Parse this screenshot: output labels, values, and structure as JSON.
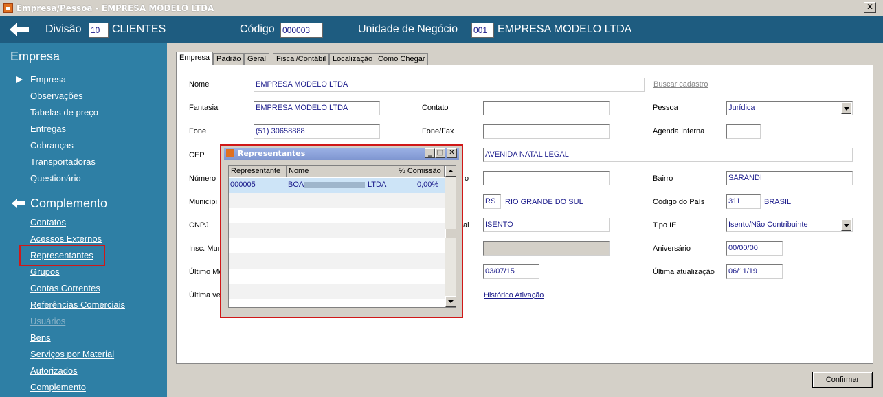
{
  "window": {
    "title": "Empresa/Pessoa - EMPRESA MODELO LTDA",
    "close": "✕"
  },
  "topbar": {
    "divisao_label": "Divisão",
    "divisao_code": "10",
    "divisao_name": "CLIENTES",
    "codigo_label": "Código",
    "codigo_value": "000003",
    "unidade_label": "Unidade de Negócio",
    "unidade_code": "001",
    "unidade_name": "EMPRESA MODELO LTDA"
  },
  "sidebar": {
    "section1": "Empresa",
    "items1": [
      "Empresa",
      "Observações",
      "Tabelas de preço",
      "Entregas",
      "Cobranças",
      "Transportadoras",
      "Questionário"
    ],
    "section2": "Complemento",
    "items2": [
      "Contatos",
      "Acessos Externos",
      "Representantes",
      "Grupos",
      "Contas Correntes",
      "Referências Comerciais",
      "Usuários",
      "Bens",
      "Serviços por Material",
      "Autorizados",
      "Complemento"
    ]
  },
  "tabs": [
    "Empresa",
    "Padrão",
    "Geral",
    "Fiscal/Contábil",
    "Localização",
    "Como Chegar"
  ],
  "form": {
    "nome_label": "Nome",
    "nome_value": "EMPRESA MODELO LTDA",
    "buscar": "Buscar cadastro",
    "fantasia_label": "Fantasia",
    "fantasia_value": "EMPRESA MODELO LTDA",
    "contato_label": "Contato",
    "contato_value": "",
    "pessoa_label": "Pessoa",
    "pessoa_value": "Jurídica",
    "fone_label": "Fone",
    "fone_value": "(51) 30658888",
    "fonefax_label": "Fone/Fax",
    "fonefax_value": "",
    "agenda_label": "Agenda Interna",
    "agenda_value": "",
    "cep_label": "CEP",
    "endereco_value": "AVENIDA NATAL LEGAL",
    "numero_label": "Número",
    "numero_mid_value": "",
    "bairro_label": "Bairro",
    "bairro_value": "SARANDI",
    "municipio_label": "Municípi",
    "uf_value": "RS",
    "estado_name": "RIO GRANDE DO SUL",
    "codpais_label": "Código do País",
    "codpais_value": "311",
    "pais_name": "BRASIL",
    "cnpj_label": "CNPJ",
    "ie_partial_label": "al",
    "ie_value": "ISENTO",
    "tipoie_label": "Tipo IE",
    "tipoie_value": "Isento/Não Contribuinte",
    "inscmun_label": "Insc. Mun",
    "aniversario_label": "Aniversário",
    "aniversario_value": "00/00/00",
    "ultimomov_label": "Último Mo",
    "data_value": "03/07/15",
    "ultatual_label": "Última atualização",
    "ultatual_value": "06/11/19",
    "ultimave_label": "Última ve",
    "historico": "Histórico Ativação",
    "mid_o": "o"
  },
  "popup": {
    "title": "Representantes",
    "headers": [
      "Representante",
      "Nome",
      "% Comissão"
    ],
    "rows": [
      {
        "representante": "000005",
        "nome_prefix": "BOA",
        "nome_suffix": "LTDA",
        "comissao": "0,00%"
      }
    ]
  },
  "confirm": "Confirmar",
  "colors": {
    "topbar": "#1e5c80",
    "sidebar": "#2e7fa5",
    "highlight": "#d01818",
    "field_text": "#1a1a8a"
  }
}
